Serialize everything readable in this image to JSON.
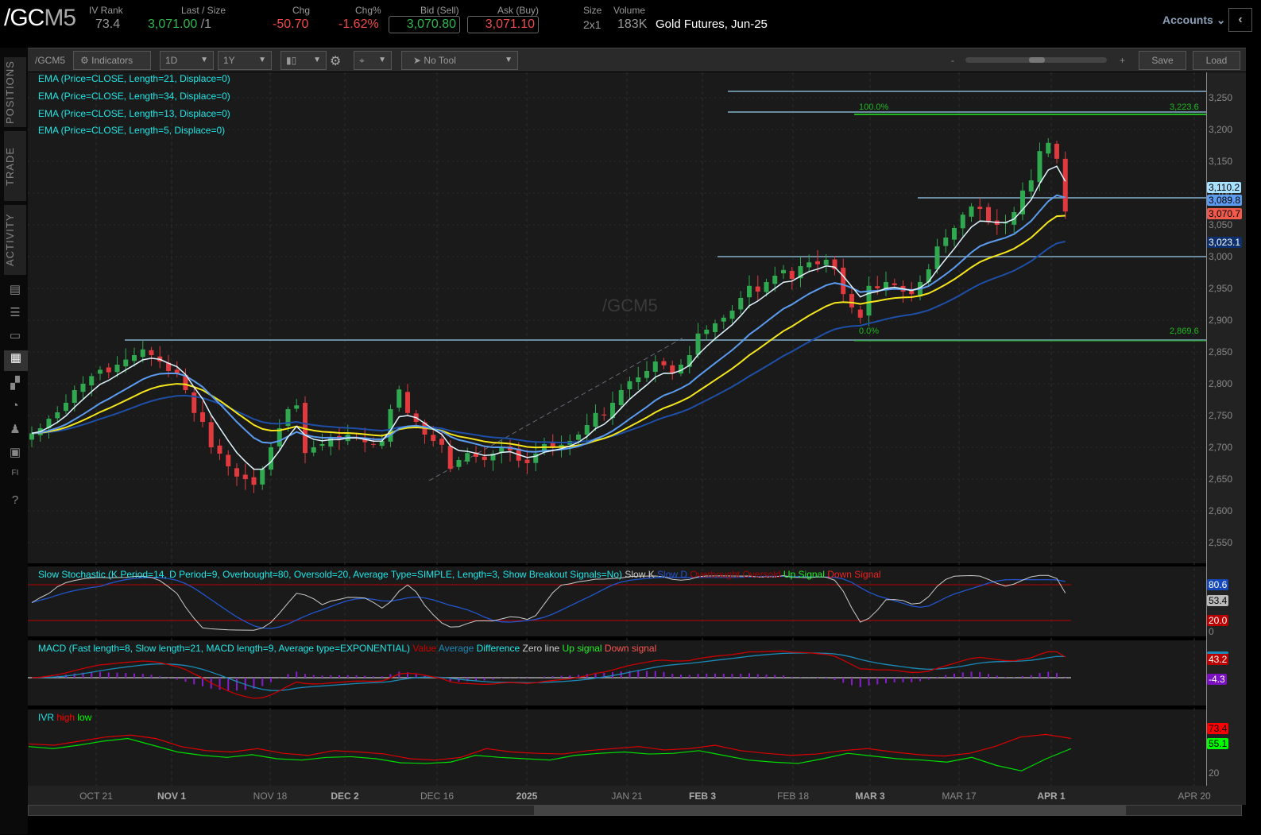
{
  "header": {
    "symbol_prefix": "/GC",
    "symbol_suffix": "M5",
    "iv_rank_label": "IV Rank",
    "iv_rank": "73.4",
    "last_label": "Last / Size",
    "last": "3,071.00",
    "last_size": "/1",
    "chg_label": "Chg",
    "chg": "-50.70",
    "chgp_label": "Chg%",
    "chgp": "-1.62%",
    "bid_label": "Bid (Sell)",
    "bid": "3,070.80",
    "ask_label": "Ask (Buy)",
    "ask": "3,071.10",
    "size_label": "Size",
    "size": "2x1",
    "volume_label": "Volume",
    "volume": "183K",
    "description": "Gold Futures, Jun-25",
    "accounts": "Accounts"
  },
  "toolbar": {
    "symbol": "/GCM5",
    "indicators": "Indicators",
    "aggregation": "1D",
    "range": "1Y",
    "tool": "No Tool",
    "zoom_minus": "-",
    "zoom_plus": "+",
    "zoom_level": 0.5,
    "save": "Save",
    "load": "Load"
  },
  "sidebar": {
    "tabs": [
      "POSITIONS",
      "TRADE",
      "ACTIVITY"
    ],
    "icons": [
      "chart-bar-icon",
      "list-icon",
      "tv-icon",
      "charts-icon",
      "grid-icon",
      "clock-icon",
      "community-icon",
      "calendar-icon",
      "fi-icon",
      "help-icon"
    ]
  },
  "studies": {
    "ema": [
      "EMA (Price=CLOSE, Length=21, Displace=0)",
      "EMA (Price=CLOSE, Length=34, Displace=0)",
      "EMA (Price=CLOSE, Length=13, Displace=0)",
      "EMA (Price=CLOSE, Length=5, Displace=0)"
    ],
    "watermark": "/GCM5",
    "stoch": {
      "title": "Slow Stochastic (K Period=14, D Period=9, Overbought=80, Oversold=20, Average Type=SIMPLE, Length=3, Show Breakout Signals=No)",
      "legend": [
        "Slow K",
        "Slow D",
        "Overbought",
        "Oversold",
        "Up Signal",
        "Down Signal"
      ]
    },
    "macd": {
      "title": "MACD (Fast length=8, Slow length=21, MACD length=9, Average type=EXPONENTIAL)",
      "legend": [
        "Value",
        "Average",
        "Difference",
        "Zero line",
        "Up signal",
        "Down signal"
      ]
    },
    "ivr": {
      "title": "IVR",
      "legend": [
        "high",
        "low"
      ]
    }
  },
  "fib": {
    "top_pct": "100.0%",
    "top_val": "3,223.6",
    "bot_pct": "0.0%",
    "bot_val": "2,869.6"
  },
  "price_axis": [
    "3,250",
    "3,200",
    "3,150",
    "3,100",
    "3,050",
    "3,000",
    "2,950",
    "2,900",
    "2,850",
    "2,800",
    "2,750",
    "2,700",
    "2,650",
    "2,600",
    "2,550"
  ],
  "price_tags": [
    {
      "v": "3,110.2",
      "bg": "#a8e0ff",
      "fg": "#000"
    },
    {
      "v": "3,089.8",
      "bg": "#5b9cf0",
      "fg": "#000"
    },
    {
      "v": "3,070.7",
      "bg": "#f05a4a",
      "fg": "#000"
    },
    {
      "v": "3,023.1",
      "bg": "#0d2f70",
      "fg": "#fff"
    }
  ],
  "stoch_tags": {
    "d": "80.6",
    "k": "53.4",
    "os": "20.0",
    "zero": "0"
  },
  "macd_tags": {
    "value": "43.2",
    "diff": "-4.3"
  },
  "ivr_tags": {
    "high": "73.4",
    "low": "55.1",
    "axis_low": "20"
  },
  "dates": [
    {
      "t": "OCT 21",
      "b": false
    },
    {
      "t": "NOV 1",
      "b": true
    },
    {
      "t": "NOV 18",
      "b": false
    },
    {
      "t": "DEC 2",
      "b": true
    },
    {
      "t": "DEC 16",
      "b": false
    },
    {
      "t": "2025",
      "b": true
    },
    {
      "t": "JAN 21",
      "b": false
    },
    {
      "t": "FEB 3",
      "b": true
    },
    {
      "t": "FEB 18",
      "b": false
    },
    {
      "t": "MAR 3",
      "b": true
    },
    {
      "t": "MAR 17",
      "b": false
    },
    {
      "t": "APR 1",
      "b": true
    },
    {
      "t": "APR 20",
      "b": false
    }
  ],
  "colors": {
    "up": "#2fa84f",
    "down": "#e0393e",
    "ema5": "#dff4ff",
    "ema13": "#5b9cf0",
    "ema21": "#f5e61c",
    "ema34": "#1e4fa8"
  },
  "chart_data": {
    "type": "candlestick",
    "ylim": [
      2530,
      3270
    ],
    "closes": [
      2722,
      2730,
      2745,
      2755,
      2770,
      2790,
      2800,
      2812,
      2822,
      2818,
      2830,
      2838,
      2845,
      2854,
      2845,
      2835,
      2820,
      2816,
      2790,
      2754,
      2740,
      2700,
      2690,
      2670,
      2654,
      2650,
      2641,
      2666,
      2700,
      2730,
      2760,
      2766,
      2691,
      2700,
      2705,
      2716,
      2712,
      2720,
      2715,
      2708,
      2704,
      2710,
      2760,
      2791,
      2754,
      2740,
      2720,
      2710,
      2704,
      2666,
      2680,
      2691,
      2685,
      2680,
      2690,
      2700,
      2695,
      2679,
      2675,
      2690,
      2705,
      2700,
      2704,
      2710,
      2720,
      2735,
      2754,
      2750,
      2770,
      2790,
      2804,
      2810,
      2820,
      2835,
      2829,
      2816,
      2830,
      2845,
      2879,
      2885,
      2895,
      2904,
      2915,
      2935,
      2954,
      2945,
      2960,
      2970,
      2979,
      2965,
      2985,
      2991,
      2988,
      2995,
      2980,
      2941,
      2920,
      2904,
      2954,
      2950,
      2960,
      2955,
      2945,
      2941,
      2960,
      2980,
      3016,
      3030,
      3045,
      3066,
      3079,
      3075,
      3054,
      3050,
      3054,
      3070,
      3104,
      3120,
      3166,
      3179,
      3154,
      3071
    ],
    "ivr_high": [
      62,
      60,
      66,
      72,
      75,
      70,
      58,
      52,
      50,
      55,
      48,
      45,
      52,
      50,
      47,
      40,
      38,
      42,
      55,
      50,
      48,
      47,
      52,
      55,
      58,
      53,
      55,
      60,
      52,
      48,
      45,
      47,
      52,
      55,
      50,
      46,
      44,
      48,
      58,
      72,
      76,
      70
    ],
    "ivr_low": [
      58,
      55,
      60,
      66,
      70,
      60,
      50,
      45,
      42,
      46,
      40,
      38,
      42,
      43,
      40,
      34,
      33,
      35,
      45,
      42,
      40,
      38,
      45,
      48,
      50,
      47,
      48,
      52,
      45,
      38,
      35,
      33,
      40,
      48,
      44,
      40,
      38,
      35,
      42,
      30,
      22,
      40,
      55
    ]
  }
}
